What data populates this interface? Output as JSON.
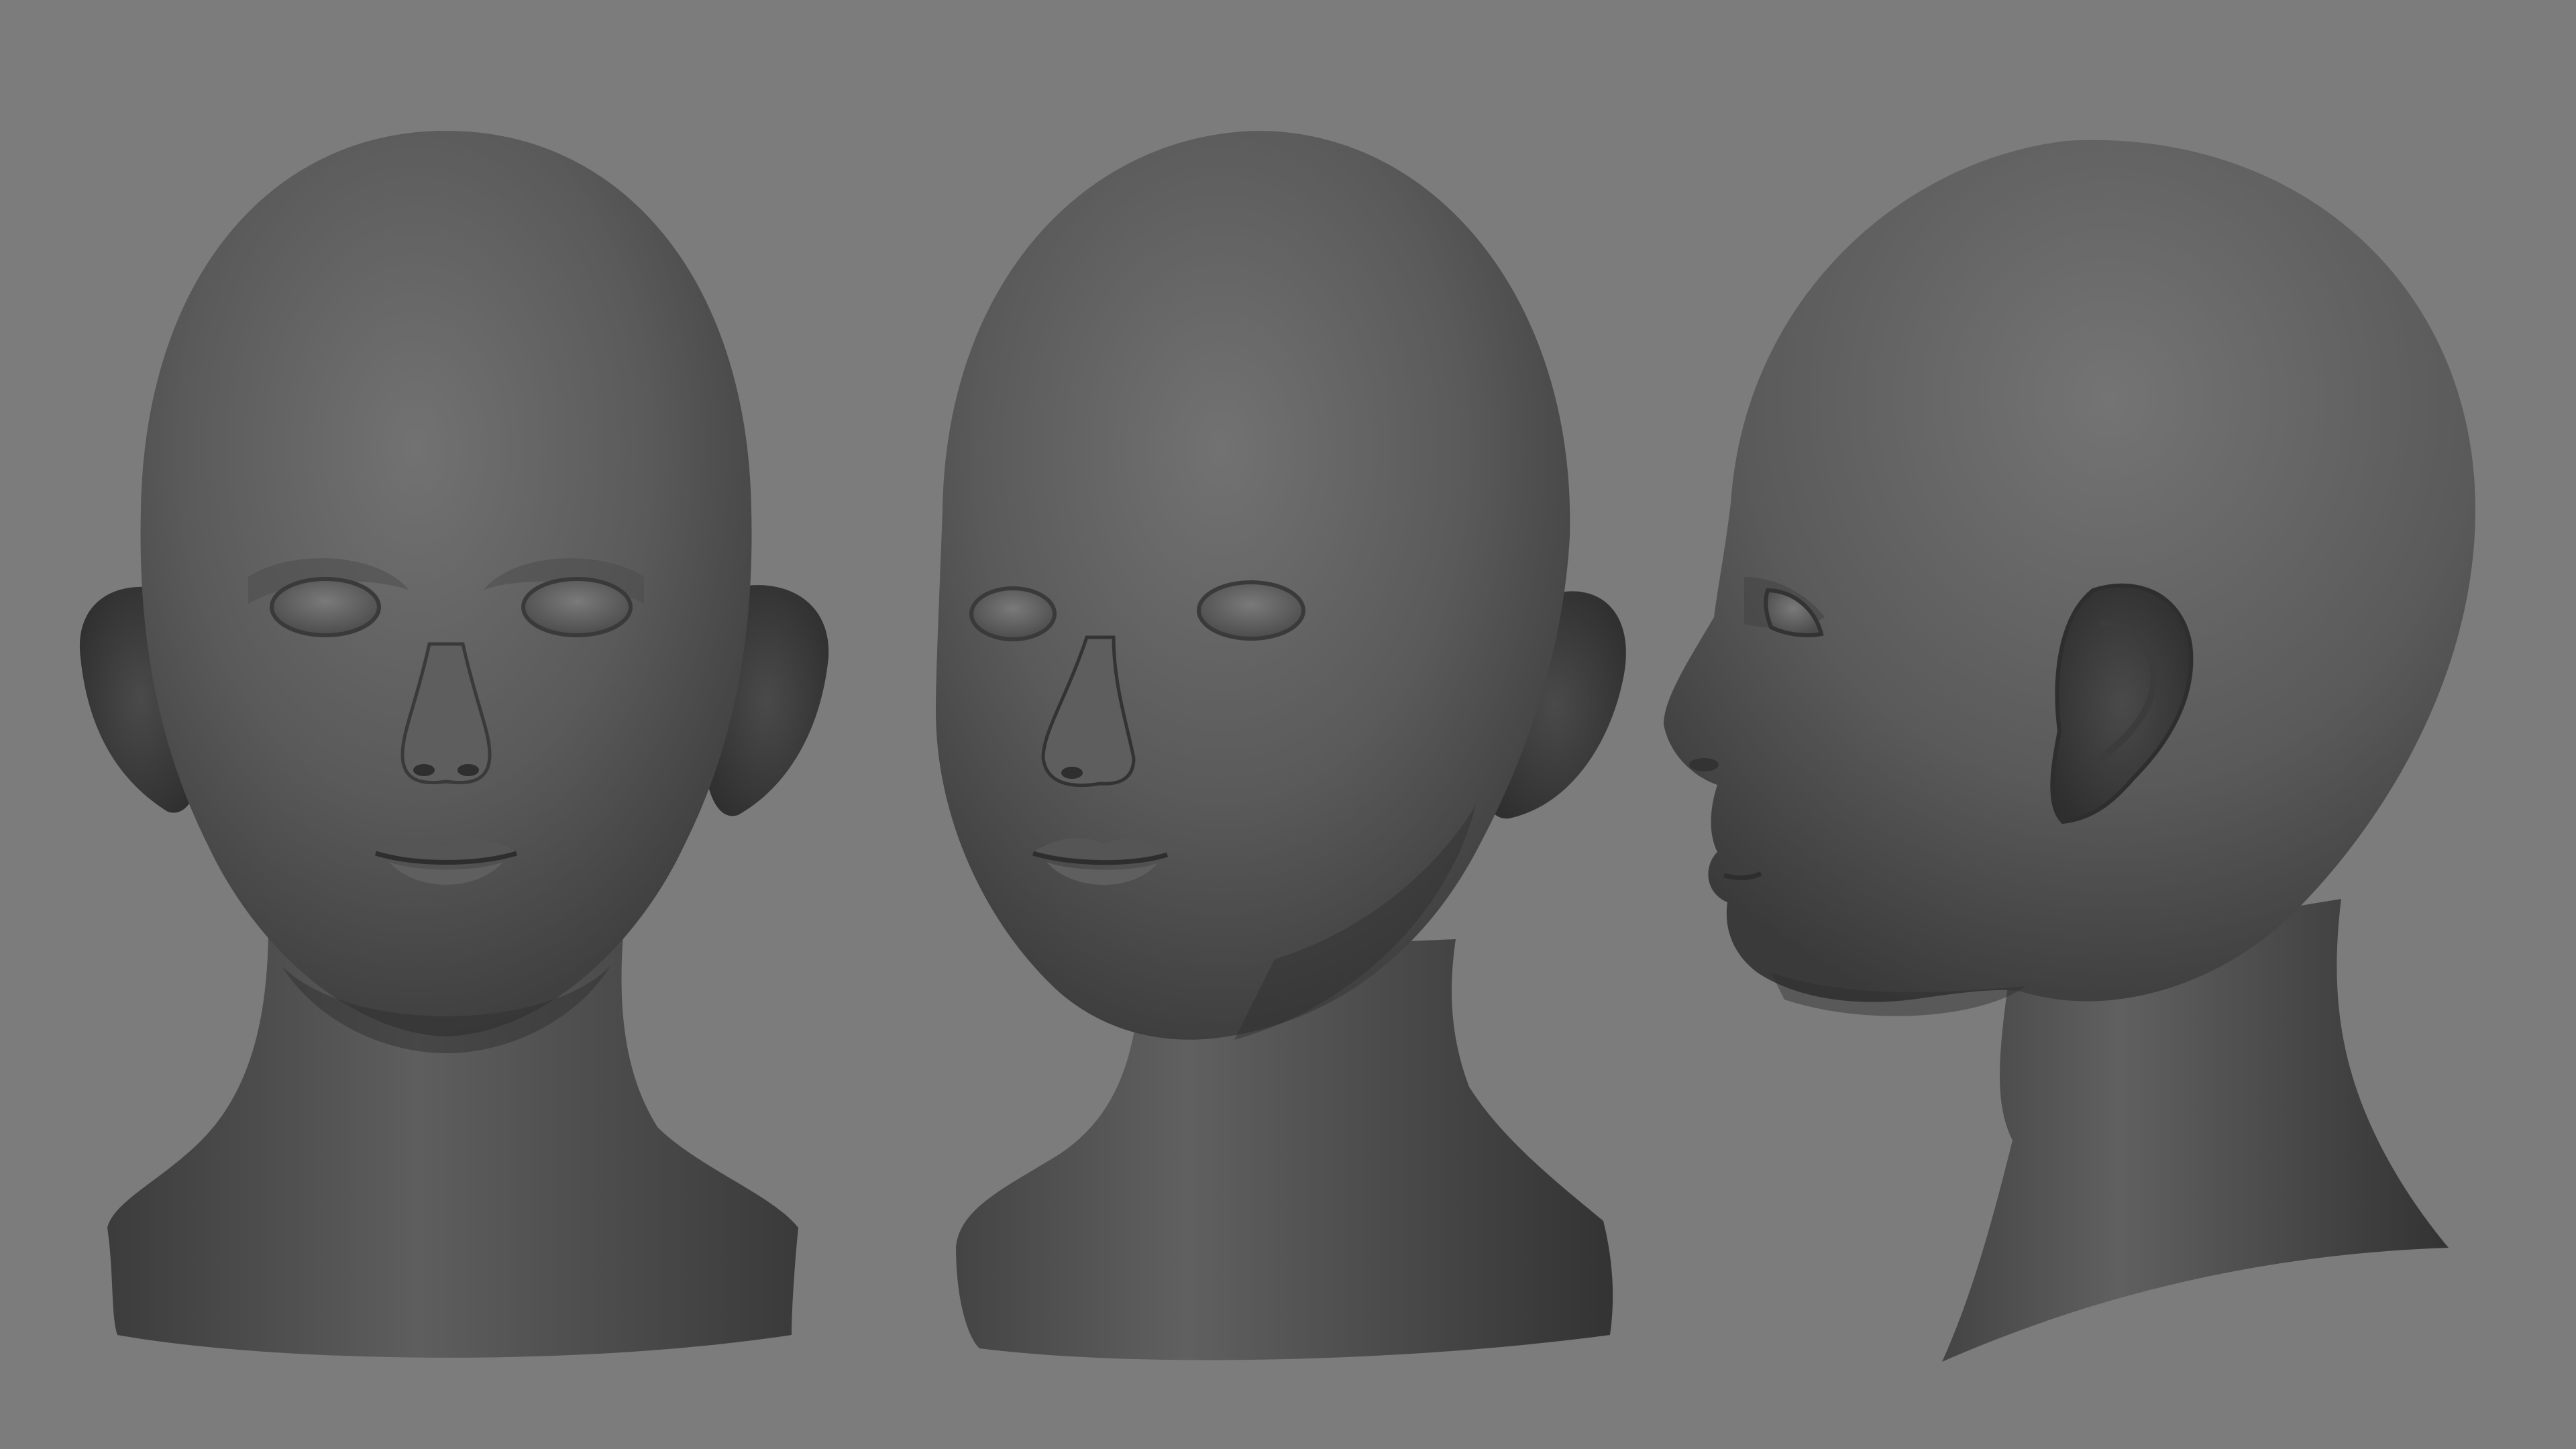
{
  "scene": {
    "background_color": "#7c7c7c",
    "clay_color": "#5a5a5a",
    "clay_highlight": "#727272",
    "clay_shadow": "#2e2e2e",
    "views": [
      {
        "name": "front-view",
        "icon": "head-front-icon"
      },
      {
        "name": "three-quarter-view",
        "icon": "head-three-quarter-icon"
      },
      {
        "name": "side-view",
        "icon": "head-profile-icon"
      }
    ]
  }
}
